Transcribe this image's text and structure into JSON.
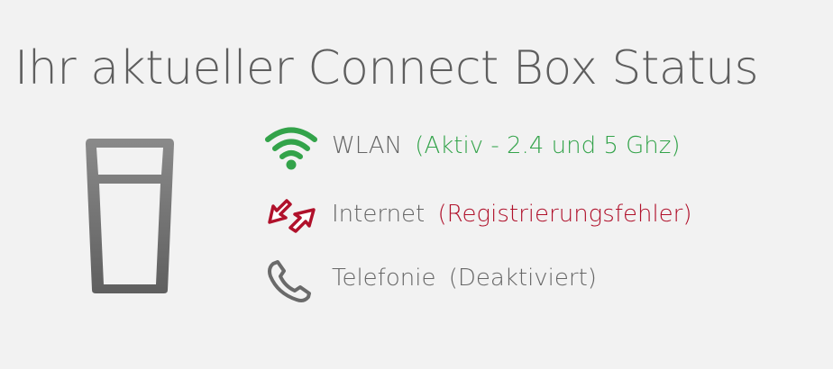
{
  "page": {
    "title": "Ihr aktueller Connect Box Status"
  },
  "colors": {
    "ok": "#33a34a",
    "error": "#b0112b",
    "neutral": "#666666",
    "background": "#f2f2f2"
  },
  "device": {
    "icon": "connect-box-device-icon"
  },
  "status": {
    "wlan": {
      "icon": "wifi-icon",
      "label": "WLAN",
      "state": "(Aktiv - 2.4 und 5 Ghz)",
      "state_color": "#33a34a"
    },
    "internet": {
      "icon": "connection-error-icon",
      "label": "Internet",
      "state": "(Registrierungsfehler)",
      "state_color": "#b0112b"
    },
    "telefonie": {
      "icon": "phone-icon",
      "label": "Telefonie",
      "state": "(Deaktiviert)",
      "state_color": "#666666"
    }
  }
}
